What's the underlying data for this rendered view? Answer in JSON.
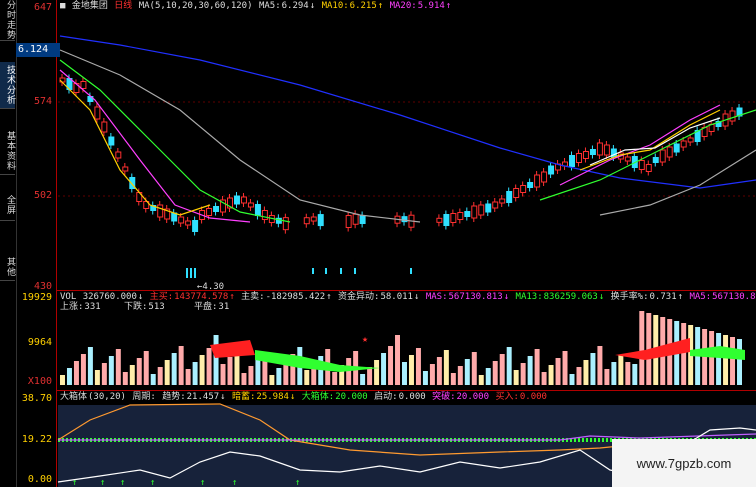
{
  "sidebar": {
    "tabs": [
      {
        "label": "分时走势",
        "active": false
      },
      {
        "label": "技术分析",
        "active": true
      },
      {
        "label": "基本资料",
        "active": false
      },
      {
        "label": "全屏",
        "active": false
      },
      {
        "label": "其他",
        "active": false
      }
    ]
  },
  "axis": {
    "price_labels": [
      "647",
      "574",
      "502",
      "430"
    ],
    "current_price": "6.124",
    "volume_labels": [
      "19929",
      "9964",
      "X100"
    ],
    "indicator_labels": [
      "38.70",
      "19.22",
      "0.00"
    ]
  },
  "chart_header": {
    "stock_name": "金地集团",
    "period": "日线",
    "ma_params": "MA(5,10,20,30,60,120)",
    "ma5_label": "MA5:",
    "ma5_value": "6.294",
    "ma10_label": "MA10:",
    "ma10_value": "6.215",
    "ma20_label": "MA20:",
    "ma20_value": "5.914",
    "low_marker": "4.30"
  },
  "volume_header": {
    "vol_label": "VOL",
    "vol_value": "326760.000",
    "main_buy_label": "主买:",
    "main_buy_value": "143774.578",
    "main_sell_label": "主卖:",
    "main_sell_value": "-182985.422",
    "fund_label": "资金异动:",
    "fund_value": "58.011",
    "mas_label": "MAS:",
    "mas_value": "567130.813",
    "ma13_label": "MA13:",
    "ma13_value": "836259.063",
    "turnover_label": "换手率%:",
    "turnover_value": "0.731",
    "ma5_label": "MA5:",
    "ma5_value": "567130.813",
    "up_label": "上涨:",
    "up_value": "331",
    "down_label": "下跌:",
    "down_value": "513",
    "flat_label": "平盘:",
    "flat_value": "31"
  },
  "indicator_header": {
    "name": "大箱体",
    "params": "(30,20)",
    "cycle_label": "周期:",
    "trend_label": "趋势:",
    "trend_value": "21.457",
    "bull_label": "暗蓄:",
    "bull_value": "25.984",
    "box_label": "大箱体:",
    "box_value": "20.000",
    "start_label": "启动:",
    "start_value": "0.000",
    "break_label": "突破:",
    "break_value": "20.000",
    "buy_label": "买入:",
    "buy_value": "0.000"
  },
  "watermark": {
    "text": "www.7gpzb.com"
  },
  "colors": {
    "background": "#000000",
    "up_candle": "#ff3030",
    "down_candle": "#30e0ff",
    "ma5": "#ffffff",
    "ma10": "#ffd000",
    "ma20": "#ff40ff",
    "ma30": "#30ff30",
    "ma60": "#aaaaaa",
    "ma120": "#2030ff"
  }
}
